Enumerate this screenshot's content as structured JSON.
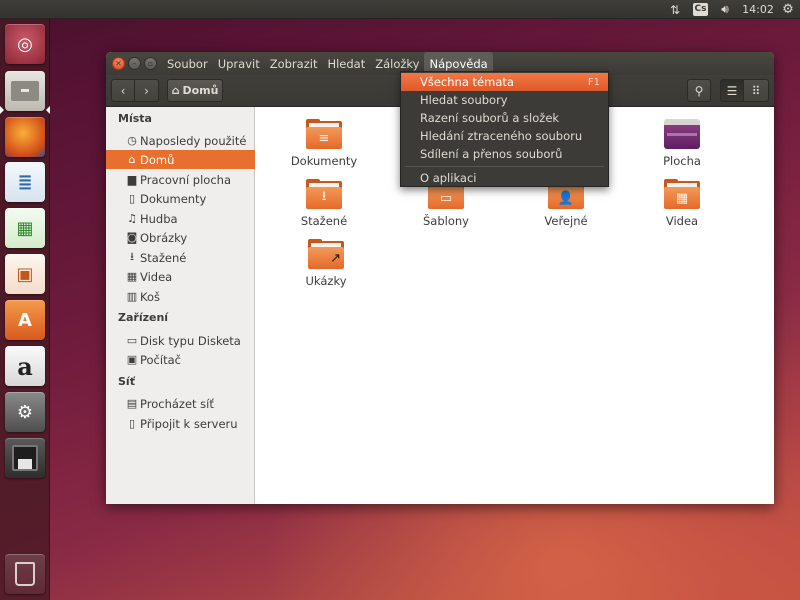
{
  "top_panel": {
    "network_icon": "network-arrows-icon",
    "keyboard_layout": "Cs",
    "volume_icon": "volume-icon",
    "clock": "14:02",
    "settings_icon": "gear-icon"
  },
  "launcher": {
    "items": [
      {
        "name": "ubuntu-dash",
        "glyph": "◎"
      },
      {
        "name": "files",
        "glyph": "▭"
      },
      {
        "name": "firefox",
        "glyph": "●"
      },
      {
        "name": "libreoffice-writer",
        "glyph": "≣"
      },
      {
        "name": "libreoffice-calc",
        "glyph": "▦"
      },
      {
        "name": "libreoffice-impress",
        "glyph": "▣"
      },
      {
        "name": "software-center",
        "glyph": "A"
      },
      {
        "name": "amazon",
        "glyph": "a"
      },
      {
        "name": "system-settings",
        "glyph": "⚙"
      },
      {
        "name": "disk",
        "glyph": "▤"
      },
      {
        "name": "trash",
        "glyph": "🗑"
      }
    ]
  },
  "window": {
    "menu": [
      "Soubor",
      "Upravit",
      "Zobrazit",
      "Hledat",
      "Záložky",
      "Nápověda"
    ],
    "toolbar": {
      "back_icon": "‹",
      "forward_icon": "›",
      "path_label": "Domů",
      "search_icon": "⚲",
      "list_icon": "☰",
      "grid_icon": "⠿"
    },
    "sidebar": {
      "places_header": "Místa",
      "places": [
        {
          "label": "Naposledy použité",
          "icon": "◷"
        },
        {
          "label": "Domů",
          "icon": "⌂"
        },
        {
          "label": "Pracovní plocha",
          "icon": "▆"
        },
        {
          "label": "Dokumenty",
          "icon": "▯"
        },
        {
          "label": "Hudba",
          "icon": "♫"
        },
        {
          "label": "Obrázky",
          "icon": "◙"
        },
        {
          "label": "Stažené",
          "icon": "⭳"
        },
        {
          "label": "Videa",
          "icon": "▦"
        },
        {
          "label": "Koš",
          "icon": "▥"
        }
      ],
      "devices_header": "Zařízení",
      "devices": [
        {
          "label": "Disk typu Disketa",
          "icon": "▭"
        },
        {
          "label": "Počítač",
          "icon": "▣"
        }
      ],
      "network_header": "Síť",
      "network": [
        {
          "label": "Procházet síť",
          "icon": "▤"
        },
        {
          "label": "Připojit k serveru",
          "icon": "▯"
        }
      ]
    },
    "files": [
      {
        "label": "Dokumenty",
        "emblem": "≡"
      },
      {
        "label": "Plocha",
        "emblem": ""
      },
      {
        "label": "Stažené",
        "emblem": "⭳"
      },
      {
        "label": "Šablony",
        "emblem": "▭"
      },
      {
        "label": "Veřejné",
        "emblem": "👤"
      },
      {
        "label": "Videa",
        "emblem": "▦"
      },
      {
        "label": "Ukázky",
        "emblem": "↗"
      }
    ],
    "help_menu": {
      "items": [
        {
          "label": "Všechna témata",
          "accel": "F1"
        },
        {
          "label": "Hledat soubory"
        },
        {
          "label": "Razení souborů a složek"
        },
        {
          "label": "Hledání ztraceného souboru"
        },
        {
          "label": "Sdílení a přenos souborů"
        },
        {
          "label": "O aplikaci"
        }
      ]
    }
  },
  "colors": {
    "accent_orange": "#e8702f",
    "panel_dark": "#3c3b37",
    "sidebar_bg": "#efeeec"
  }
}
